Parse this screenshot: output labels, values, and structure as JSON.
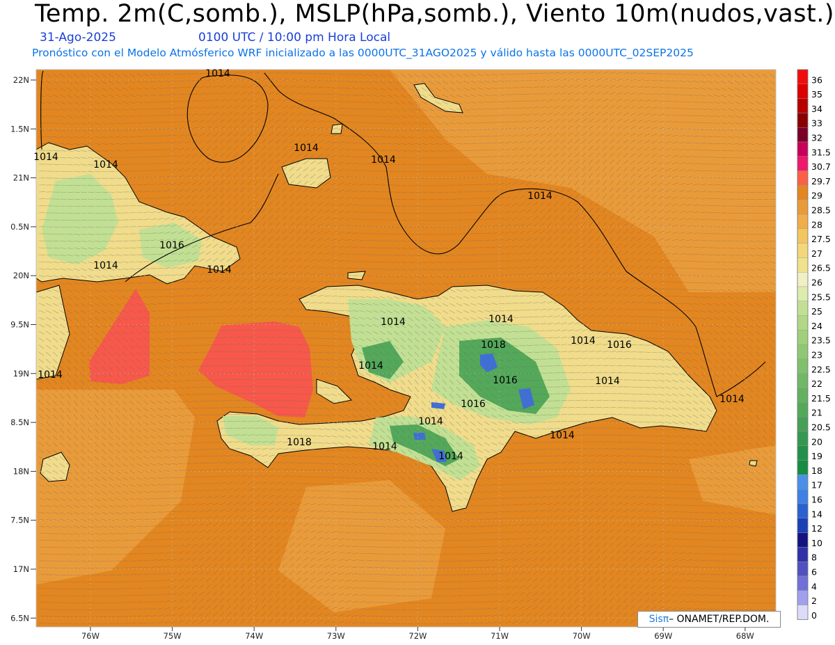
{
  "header": {
    "title": "Temp. 2m(C,somb.), MSLP(hPa,somb.), Viento 10m(nudos,vast.)",
    "date": "31-Ago-2025",
    "time": "0100 UTC / 10:00 pm Hora Local",
    "description": "Pronóstico con el Modelo Atmósferico WRF inicializado a las 0000UTC_31AGO2025 y válido hasta las  0000UTC_02SEP2025"
  },
  "map": {
    "lat_labels": [
      "22N",
      "1.5N",
      "21N",
      "0.5N",
      "20N",
      "9.5N",
      "19N",
      "8.5N",
      "18N",
      "7.5N",
      "17N",
      "6.5N"
    ],
    "lon_labels": [
      "76W",
      "75W",
      "74W",
      "73W",
      "72W",
      "71W",
      "70W",
      "69W",
      "68W"
    ],
    "isobar_labels": [
      "1014",
      "1014",
      "1014",
      "1014",
      "1014",
      "1014",
      "1016",
      "1014",
      "1014",
      "1014",
      "1014",
      "1014",
      "1014",
      "1016",
      "1018",
      "1016",
      "1014",
      "1014",
      "1014",
      "1016",
      "1014",
      "1014",
      "1018",
      "1014",
      "1014"
    ],
    "colors": {
      "sea": "#e3861f",
      "sea_light": "#ea9b39",
      "hot": "#f7584a",
      "land_low": "#f0dc8a",
      "land_mid": "#c2e093",
      "land_high": "#8fc873",
      "land_top": "#53a85a",
      "cold": "#3f6fd6"
    }
  },
  "legend": {
    "labels": [
      "36",
      "35",
      "34",
      "33",
      "32",
      "31.5",
      "30.7",
      "29.7",
      "29",
      "28.5",
      "28",
      "27.5",
      "27",
      "26.5",
      "26",
      "25.5",
      "25",
      "24",
      "23.5",
      "23",
      "22.5",
      "22",
      "21.5",
      "21",
      "20.5",
      "20",
      "19",
      "18",
      "17",
      "16",
      "14",
      "12",
      "10",
      "8",
      "6",
      "4",
      "2",
      "0"
    ],
    "colors": [
      "#f20d0d",
      "#dc0000",
      "#b80000",
      "#8b0000",
      "#7a0026",
      "#c8005a",
      "#f0186a",
      "#fa6045",
      "#e3861f",
      "#ea9b39",
      "#f0ad4a",
      "#f4c660",
      "#f4d77a",
      "#f0e28c",
      "#f1f0c4",
      "#dcecae",
      "#c2e093",
      "#b0d885",
      "#a0d07a",
      "#8fc873",
      "#80c06c",
      "#70b866",
      "#62b060",
      "#53a85a",
      "#44a055",
      "#359850",
      "#22904a",
      "#168c44",
      "#4a90e8",
      "#3f80e6",
      "#2a60d0",
      "#1a40b8",
      "#141480",
      "#3030a8",
      "#5050c0",
      "#7070d8",
      "#a0a0ee",
      "#dcdcfa"
    ]
  },
  "credit": {
    "logo": "Sisπ",
    "text": "– ONAMET/REP.DOM."
  }
}
